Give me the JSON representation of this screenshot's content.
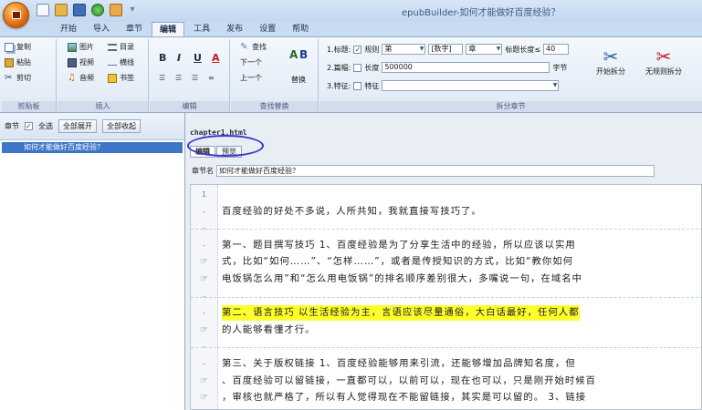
{
  "app": {
    "title": "epubBuilder-如何才能做好百度经验？"
  },
  "ribbon_tabs": [
    "开始",
    "导入",
    "章节",
    "编辑",
    "工具",
    "发布",
    "设置",
    "帮助"
  ],
  "active_tab_index": 3,
  "ribbon": {
    "clipboard": {
      "copy": "复制",
      "paste": "粘贴",
      "cut": "剪切",
      "label": "剪贴板"
    },
    "insert": {
      "image": "图片",
      "toc": "目录",
      "video": "视频",
      "separator": "横线",
      "audio": "音频",
      "bookmark": "书签",
      "label": "插入"
    },
    "edit": {
      "bold": "B",
      "italic": "I",
      "underline": "U",
      "font_color": "A",
      "label": "编辑"
    },
    "find_replace": {
      "find": "查找",
      "next": "下一个",
      "prev": "上一个",
      "replace": "替换",
      "label": "查找替换"
    },
    "split": {
      "row1_prefix": "1.标题:",
      "row1_check": "规则",
      "row1_select1": "第",
      "row1_select2": "[数字]",
      "row1_select3": "章",
      "row1_maxlen_label": "标题长度≤",
      "row1_maxlen": "40",
      "row2_prefix": "2.篇幅:",
      "row2_check": "长度",
      "row2_value": "500000",
      "row2_unit": "字节",
      "row3_prefix": "3.特征:",
      "row3_check": "特征",
      "row3_value": "",
      "start_split": "开始拆分",
      "no_split": "无规则拆分",
      "label": "拆分章节"
    }
  },
  "left_panel": {
    "chapter_label": "章节",
    "select_all": "全选",
    "expand_all": "全部展开",
    "collapse_all": "全部收起",
    "items": [
      "如何才能做好百度经验？"
    ]
  },
  "editor": {
    "file_tab": "chapter1.html",
    "tabs": [
      "编辑",
      "预览"
    ],
    "active_tab": 0,
    "chapter_name_label": "章节名",
    "chapter_name": "如何才能做好百度经验？",
    "lines": [
      {
        "gutter": "1",
        "text": "",
        "highlight": false
      },
      {
        "gutter": "-",
        "text": "    百度经验的好处不多说，人所共知，我就直接写技巧了。",
        "highlight": false
      },
      {
        "gutter": "-",
        "text": "",
        "highlight": false
      },
      {
        "gutter": "-",
        "text": "第一、题目撰写技巧    1、百度经验是为了分享生活中的经验，所以应该以实用",
        "highlight": false
      },
      {
        "gutter": "↵",
        "text": "式，比如“如何……”、“怎样……”，或者是传授知识的方式，比如“教你如何",
        "highlight": false
      },
      {
        "gutter": "↵",
        "text": "电饭锅怎么用”和“怎么用电饭锅”的排名顺序差别很大，多嘴说一句，在域名中",
        "highlight": false
      },
      {
        "gutter": "-",
        "text": "",
        "highlight": false
      },
      {
        "gutter": "-",
        "text": "第二、语言技巧    以生活经验为主，言语应该尽量通俗，大白话最好，任何人都",
        "highlight": true
      },
      {
        "gutter": "↵",
        "text": "的人能够看懂才行。",
        "highlight": false
      },
      {
        "gutter": "-",
        "text": "",
        "highlight": false
      },
      {
        "gutter": "-",
        "text": "第三、关于版权链接    1、百度经验能够用来引流，还能够增加品牌知名度，但",
        "highlight": false
      },
      {
        "gutter": "↵",
        "text": "、百度经验可以留链接，一直都可以，以前可以，现在也可以，只是刚开始时候百",
        "highlight": false
      },
      {
        "gutter": "↵",
        "text": "，审核也就严格了，所以有人觉得现在不能留链接，其实是可以留的。    3、链接",
        "highlight": false
      }
    ]
  },
  "colors": {
    "accent": "#3e75c9",
    "highlight": "#ffff2e",
    "ring": "#3b35c9"
  }
}
